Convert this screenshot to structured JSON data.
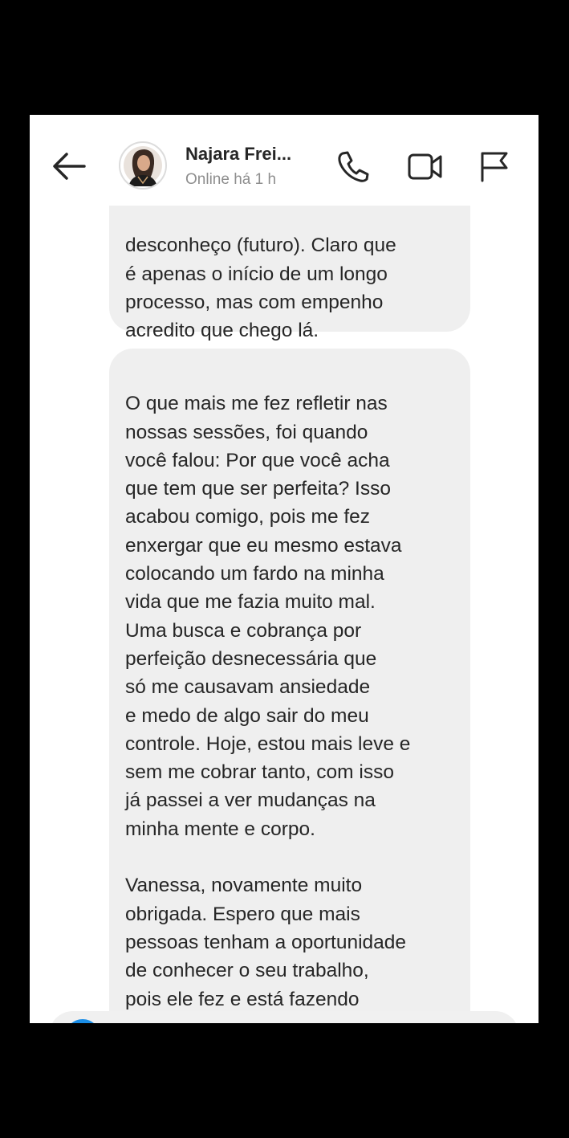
{
  "header": {
    "contact_name": "Najara Frei...",
    "status": "Online há 1 h",
    "icons": {
      "back": "arrow-left-icon",
      "call": "phone-icon",
      "video": "video-camera-icon",
      "report": "flag-icon"
    }
  },
  "messages": [
    {
      "text": "desconheço (futuro). Claro que\né apenas o início de um longo\nprocesso, mas com empenho\nacredito que chego lá."
    },
    {
      "text": "O que mais me fez refletir nas\nnossas sessões, foi quando\nvocê falou: Por que você acha\nque tem que ser perfeita? Isso\nacabou comigo, pois me fez\nenxergar que eu mesmo estava\ncolocando um fardo na minha\nvida que me fazia muito mal.\nUma busca e cobrança por\nperfeição desnecessária que\nsó me causavam ansiedade\ne medo de algo sair do meu\ncontrole. Hoje, estou mais leve e\nsem me cobrar tanto, com isso\njá passei a ver mudanças na\nminha mente e corpo.\n\nVanessa, novamente muito\nobrigada. Espero que mais\npessoas tenham a oportunidade\nde conhecer o seu trabalho,\npois ele fez e está fazendo\ntoda a diferença na minha vida"
    }
  ],
  "colors": {
    "background": "#000000",
    "screen": "#ffffff",
    "bubble": "#efefef",
    "text": "#262626",
    "status_text": "#8e8e8e",
    "accent": "#1a8de6"
  }
}
